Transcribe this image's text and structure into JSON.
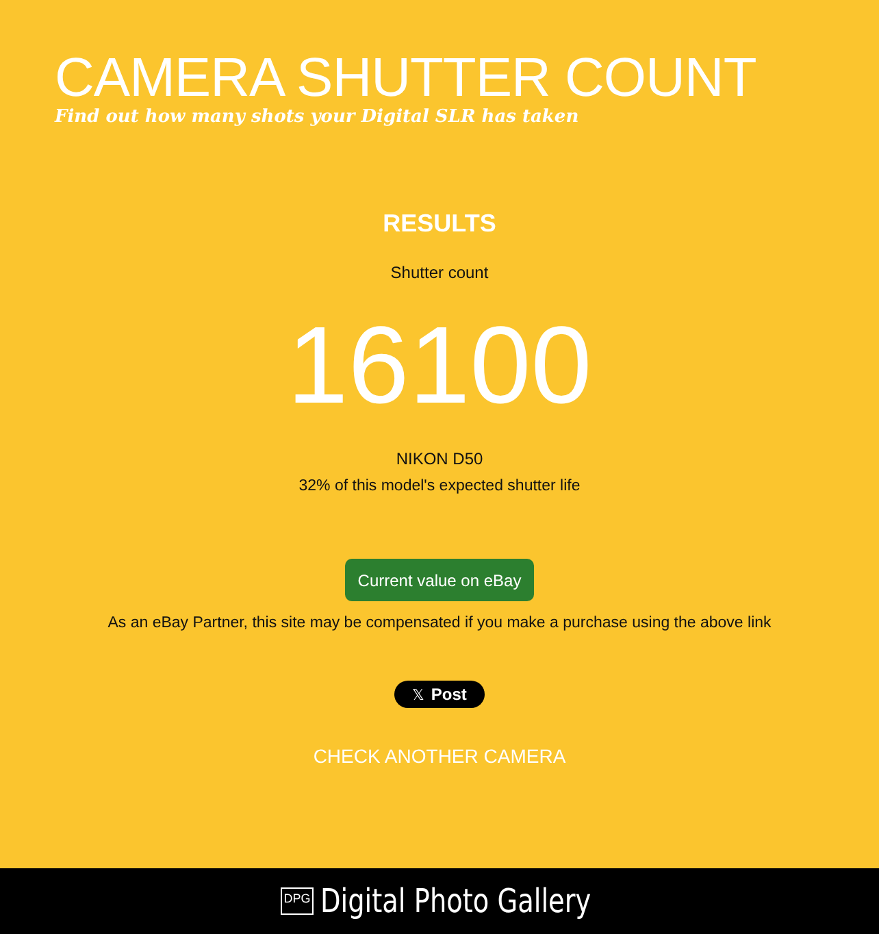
{
  "header": {
    "title": "CAMERA SHUTTER COUNT",
    "subtitle": "Find out how many shots your Digital SLR has taken"
  },
  "results": {
    "heading": "RESULTS",
    "label": "Shutter count",
    "count": "16100",
    "model": "NIKON D50",
    "life": "32% of this model's expected shutter life"
  },
  "ebay_button": "Current value on eBay",
  "disclaimer": "As an eBay Partner, this site may be compensated if you make a purchase using the above link",
  "post_button": {
    "icon": "𝕏",
    "label": "Post"
  },
  "check_link": "CHECK ANOTHER CAMERA",
  "footer": {
    "logo_mark": "DPG",
    "logo_text": "Digital Photo Gallery"
  }
}
